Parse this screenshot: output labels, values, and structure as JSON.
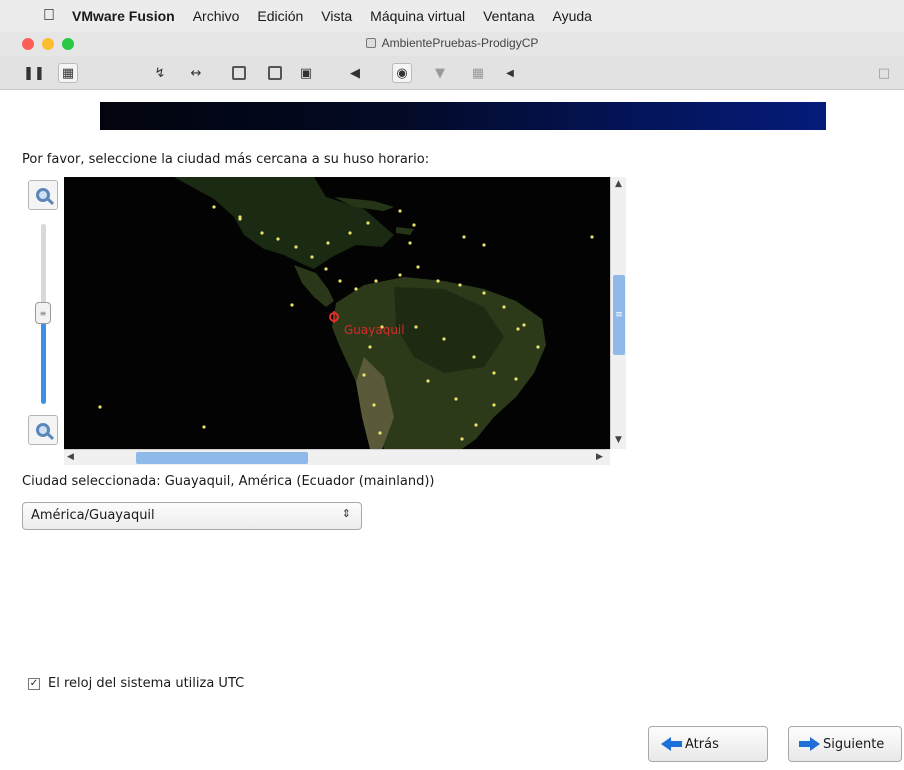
{
  "menubar": {
    "app_name": "VMware Fusion",
    "items": [
      "Archivo",
      "Edición",
      "Vista",
      "Máquina virtual",
      "Ventana",
      "Ayuda"
    ]
  },
  "window": {
    "title": "AmbientePruebas-ProdigyCP",
    "traffic_lights": [
      "#fc5f57",
      "#fdbc2e",
      "#28c840"
    ]
  },
  "toolbar": {
    "icons": [
      "pause-icon",
      "snapshot-icon",
      "settings-wrench-icon",
      "resize-arrows-icon",
      "disk-icon",
      "disk-icon",
      "printer-icon",
      "sound-icon",
      "camera-icon",
      "usb-icon",
      "network-icon",
      "more-icon",
      "fullscreen-icon"
    ]
  },
  "installer": {
    "prompt": "Por favor, seleccione la ciudad más cercana a su huso horario:",
    "map": {
      "selected_city_label": "Guayaquil",
      "marker_color": "#e03030"
    },
    "selected_city_text": "Ciudad seleccionada: Guayaquil, América (Ecuador (mainland))",
    "timezone_select": {
      "value": "América/Guayaquil"
    },
    "utc_checkbox": {
      "label": "El reloj del sistema utiliza UTC",
      "checked": true
    },
    "buttons": {
      "back": "Atrás",
      "next": "Siguiente"
    }
  }
}
